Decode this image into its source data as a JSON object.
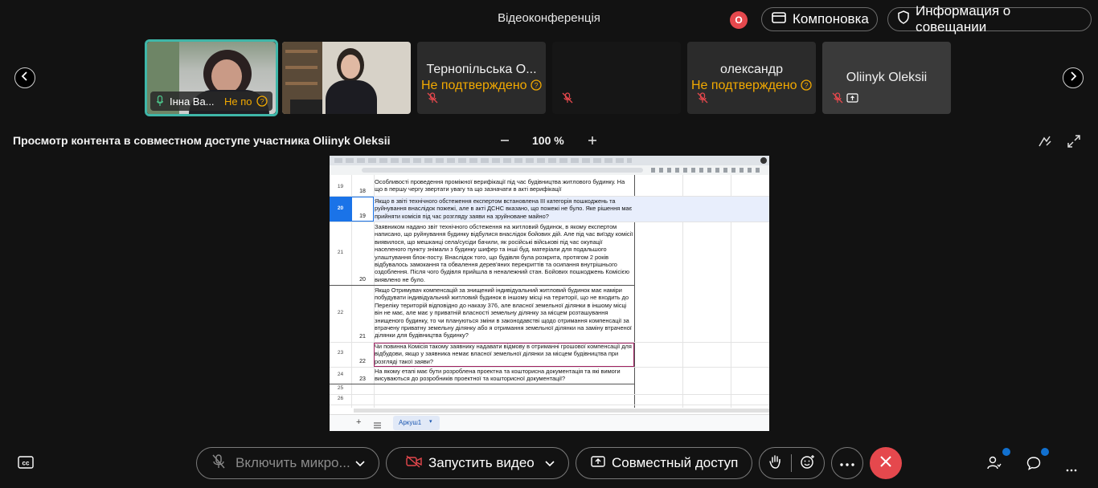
{
  "header": {
    "title": "Відеоконференція",
    "record_badge": "О",
    "layout_label": "Компоновка",
    "meeting_info_label": "Информация о совещании"
  },
  "participants": [
    {
      "name": "Інна Ва...",
      "status": "Не по"
    },
    {
      "name": "",
      "status": ""
    },
    {
      "name": "Тернопільська О...",
      "status": "Не подтверждено"
    },
    {
      "name": "",
      "status": ""
    },
    {
      "name": "олександр",
      "status": "Не подтверждено"
    },
    {
      "name": "Oliinyk Oleksii",
      "status": ""
    }
  ],
  "share": {
    "label": "Просмотр контента в совместном доступе участника Oliinyk Oleksii",
    "zoom": "100 %"
  },
  "sheet": {
    "tab_name": "Аркуш1",
    "rows": [
      {
        "row": "19",
        "num": "18",
        "text": "Особливості проведення проміжної верифікації під час будівництва житлового будинку. На що в першу чергу звертати увагу та що зазначати в акті верифікації"
      },
      {
        "row": "20",
        "num": "19",
        "text": "Якщо в звіті технічного обстеження експертом встановлена ІІІ категорія пошкоджень та руйнування внаслідок пожежі, але в акті ДСНС вказано, що пожежі не було. Яке рішення має прийняти комісія під час розгляду заяви на зруйноване майно?"
      },
      {
        "row": "21",
        "num": "20",
        "text": "Заявником надано звіт технічного обстеження на житловий будинок, в якому експертом написано, що руйнування будинку відбулися внаслідок бойових дій. Але під час виїзду комісії виявилося, що мешканці села/сусіди бачили, як російські військові під час окупації населеного пункту знімали з будинку шифер та інші буд. матеріали для подальшого улаштування блок-посту. Внаслідок того, що будівля була розкрита, протягом 2 років відбувалось замокання та обвалення дерев'яних перекриттів та осипання внутрішнього оздоблення. Після чого будівля прийшла в неналежний стан. Бойових пошкоджень Комісією виявлено не було."
      },
      {
        "row": "22",
        "num": "21",
        "text": "Якщо Отримувач компенсацій за знищений індивідуальний житловий будинок має наміри побудувати індивідуальний житловий будинок в іншому місці на території, що не входить до Переліку територій відповідно до наказу 376, але власної земельної ділянки в іншому місці він не має, але має у приватній власності земельну ділянку за місцем розташування знищеного будинку, то чи плануються зміни в законодавстві щодо отримання компенсації за втрачену приватну земельну ділянку або я отримання земельної ділянки на заміну втраченої ділянки для будівництва будинку?"
      },
      {
        "row": "23",
        "num": "22",
        "text": "Чи повинна Комісія такому заявнику надавати відмову в отриманні грошової компенсації для відбудови, якщо у заявника немає власної земельної ділянки за місцем будівництва при розгляді такої заяви?"
      },
      {
        "row": "24",
        "num": "23",
        "text": "На якому етапі має бути розроблена проектна та кошторисна документація та які вимоги висуваються до розробників проектної та кошторисної документації?"
      },
      {
        "row": "25",
        "num": "",
        "text": ""
      },
      {
        "row": "26",
        "num": "",
        "text": ""
      }
    ]
  },
  "bottom": {
    "mic_label": "Включить микро...",
    "video_label": "Запустить видео",
    "share_label": "Совместный доступ"
  },
  "colors": {
    "accent_selected": "#3fb6a8",
    "unconfirmed": "#f2a900",
    "end_call": "#e5484d",
    "notify_dot": "#1170cf"
  }
}
